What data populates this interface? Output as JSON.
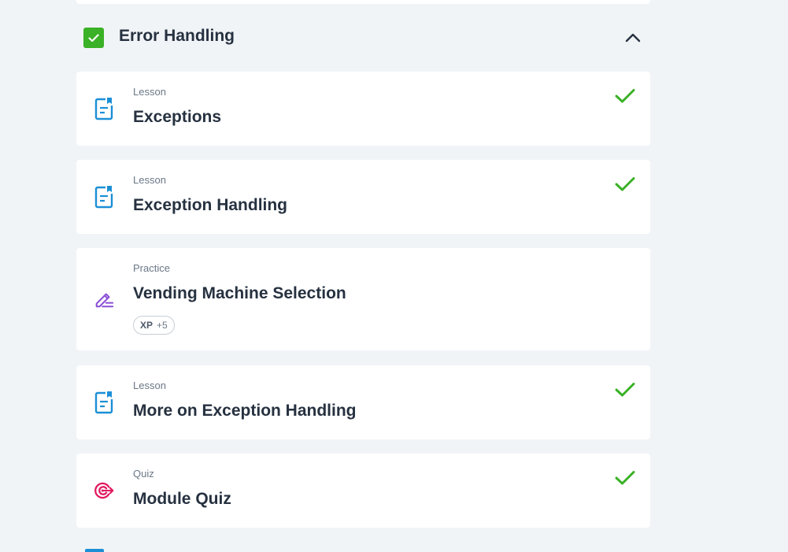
{
  "module": {
    "title": "Error Handling",
    "completed": true,
    "expanded": true,
    "check_color": "#3ab126"
  },
  "items": [
    {
      "type": "Lesson",
      "title": "Exceptions",
      "icon": "lesson-document-icon",
      "completed": true
    },
    {
      "type": "Lesson",
      "title": "Exception Handling",
      "icon": "lesson-document-icon",
      "completed": true
    },
    {
      "type": "Practice",
      "title": "Vending Machine Selection",
      "icon": "practice-pencil-icon",
      "completed": false,
      "xp_label": "XP",
      "xp_value": "+5"
    },
    {
      "type": "Lesson",
      "title": "More on Exception Handling",
      "icon": "lesson-document-icon",
      "completed": true
    },
    {
      "type": "Quiz",
      "title": "Module Quiz",
      "icon": "quiz-target-icon",
      "completed": true
    }
  ],
  "colors": {
    "lesson_icon": "#1c8fd6",
    "practice_icon": "#8b4fd8",
    "quiz_icon": "#e0195f",
    "done_check": "#3ab126",
    "text_primary": "#263140",
    "text_secondary": "#6b7787"
  }
}
